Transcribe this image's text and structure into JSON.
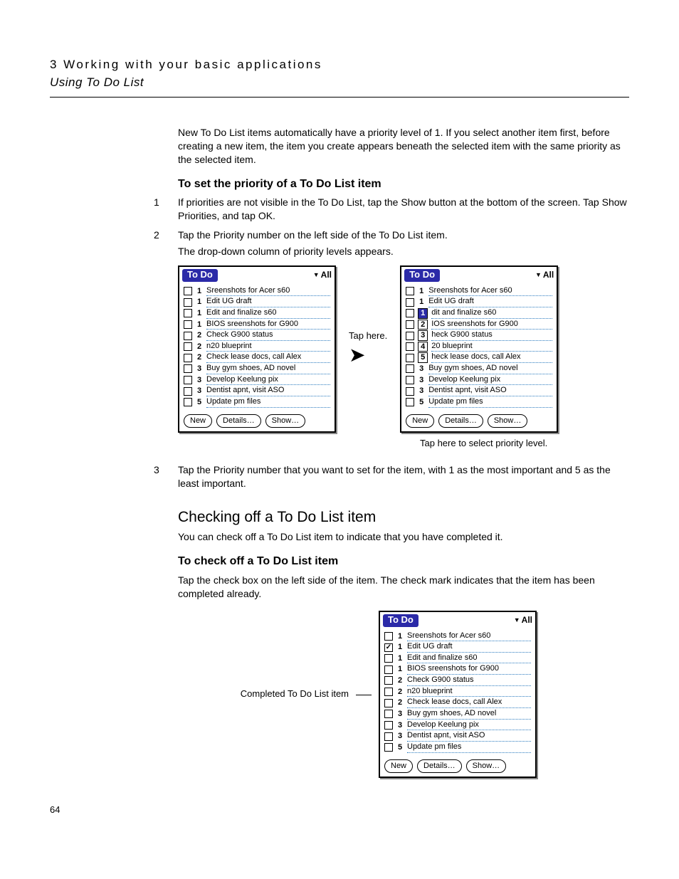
{
  "header": {
    "chapter": "3 Working with your basic applications",
    "section": "Using To Do List"
  },
  "intro": "New To Do List items automatically have a priority level of 1. If you select another item first, before creating a new item, the item you create appears beneath the selected item with the same priority as the selected item.",
  "set_priority": {
    "heading": "To set the priority of a To Do List item",
    "steps": {
      "s1_num": "1",
      "s1": "If priorities are not visible in the To Do List, tap the Show button at the bottom of the screen. Tap Show Priorities, and tap OK.",
      "s2_num": "2",
      "s2": "Tap the Priority number on the left side of the To Do List item.",
      "s2_note": "The drop-down column of priority levels appears.",
      "s3_num": "3",
      "s3": "Tap the Priority number that you want to set for the item, with 1 as the most important and 5 as the least important."
    },
    "callout_tap_here": "Tap here.",
    "callout_select": "Tap here to select priority level."
  },
  "checking": {
    "heading": "Checking off a To Do List item",
    "para": "You can check off a To Do List item to indicate that you have completed it.",
    "sub": "To check off a To Do List item",
    "para2": "Tap the check box on the left side of the item. The check mark indicates that the item has been completed already.",
    "callout": "Completed To Do List item"
  },
  "palm_common": {
    "title": "To Do",
    "category": "All",
    "btn_new": "New",
    "btn_details": "Details…",
    "btn_show": "Show…"
  },
  "palm_left": {
    "rows": [
      {
        "p": "1",
        "t": "Sreenshots for Acer s60"
      },
      {
        "p": "1",
        "t": "Edit UG draft"
      },
      {
        "p": "1",
        "t": "Edit and finalize s60"
      },
      {
        "p": "1",
        "t": "BIOS sreenshots for G900"
      },
      {
        "p": "2",
        "t": "Check G900 status"
      },
      {
        "p": "2",
        "t": "n20 blueprint"
      },
      {
        "p": "2",
        "t": "Check lease docs, call Alex"
      },
      {
        "p": "3",
        "t": "Buy gym shoes, AD novel"
      },
      {
        "p": "3",
        "t": "Develop Keelung pix"
      },
      {
        "p": "3",
        "t": "Dentist apnt, visit ASO"
      },
      {
        "p": "5",
        "t": "Update pm files"
      }
    ]
  },
  "palm_right": {
    "rows": [
      {
        "p": "1",
        "t": "Sreenshots for Acer s60",
        "box": false
      },
      {
        "p": "1",
        "t": "Edit UG draft",
        "box": false
      },
      {
        "p": "1",
        "t": "dit and finalize s60",
        "box": true,
        "sel": true
      },
      {
        "p": "2",
        "t": "IOS sreenshots for G900",
        "box": true
      },
      {
        "p": "3",
        "t": "heck G900 status",
        "box": true
      },
      {
        "p": "4",
        "t": "20 blueprint",
        "box": true
      },
      {
        "p": "5",
        "t": "heck lease docs, call Alex",
        "box": true
      },
      {
        "p": "3",
        "t": "Buy gym shoes, AD novel",
        "box": false
      },
      {
        "p": "3",
        "t": "Develop Keelung pix",
        "box": false
      },
      {
        "p": "3",
        "t": "Dentist apnt, visit ASO",
        "box": false
      },
      {
        "p": "5",
        "t": "Update pm files",
        "box": false
      }
    ]
  },
  "palm_check": {
    "rows": [
      {
        "p": "1",
        "t": "Sreenshots for Acer s60",
        "c": false
      },
      {
        "p": "1",
        "t": "Edit UG draft",
        "c": true
      },
      {
        "p": "1",
        "t": "Edit and finalize s60",
        "c": false
      },
      {
        "p": "1",
        "t": "BIOS sreenshots for G900",
        "c": false
      },
      {
        "p": "2",
        "t": "Check G900 status",
        "c": false
      },
      {
        "p": "2",
        "t": "n20 blueprint",
        "c": false
      },
      {
        "p": "2",
        "t": "Check lease docs, call Alex",
        "c": false
      },
      {
        "p": "3",
        "t": "Buy gym shoes, AD novel",
        "c": false
      },
      {
        "p": "3",
        "t": "Develop Keelung pix",
        "c": false
      },
      {
        "p": "3",
        "t": "Dentist apnt, visit ASO",
        "c": false
      },
      {
        "p": "5",
        "t": "Update pm files",
        "c": false
      }
    ]
  },
  "page_number": "64"
}
